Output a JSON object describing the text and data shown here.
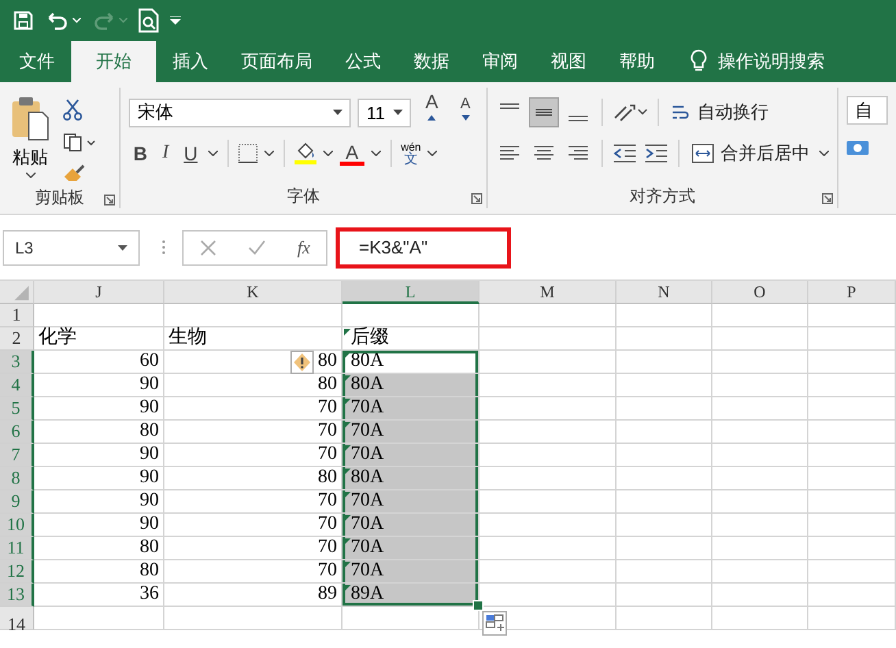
{
  "tabs": [
    {
      "label": "文件",
      "selected": false
    },
    {
      "label": "开始",
      "selected": true
    },
    {
      "label": "插入",
      "selected": false
    },
    {
      "label": "页面布局",
      "selected": false
    },
    {
      "label": "公式",
      "selected": false
    },
    {
      "label": "数据",
      "selected": false
    },
    {
      "label": "审阅",
      "selected": false
    },
    {
      "label": "视图",
      "selected": false
    },
    {
      "label": "帮助",
      "selected": false
    }
  ],
  "tell_me": "操作说明搜索",
  "ribbon": {
    "clipboard": {
      "paste": "粘贴",
      "label": "剪贴板"
    },
    "font": {
      "name": "宋体",
      "size": "11",
      "grow": "A",
      "shrink": "A",
      "bold": "B",
      "italic": "I",
      "underline": "U",
      "font_color": "A",
      "phonetic_top": "wén",
      "phonetic_bottom": "文",
      "label": "字体"
    },
    "alignment": {
      "wrap_text": "自动换行",
      "merge": "合并后居中",
      "label": "对齐方式"
    },
    "number_format": "自"
  },
  "formula_bar": {
    "name_box": "L3",
    "fx": "fx",
    "formula": "=K3&\"A\"",
    "highlighted": true
  },
  "columns": [
    {
      "label": "J",
      "selected": false
    },
    {
      "label": "K",
      "selected": false
    },
    {
      "label": "L",
      "selected": true
    },
    {
      "label": "M",
      "selected": false
    },
    {
      "label": "N",
      "selected": false
    },
    {
      "label": "O",
      "selected": false
    },
    {
      "label": "P",
      "selected": false
    }
  ],
  "rows": [
    {
      "number": "1",
      "selected": false
    },
    {
      "number": "2",
      "selected": false,
      "kind": "header",
      "j": "化学",
      "k": "生物",
      "l": "后缀"
    },
    {
      "number": "3",
      "selected": true,
      "active": true,
      "j": "60",
      "k": "80",
      "l": "80A",
      "warning": true
    },
    {
      "number": "4",
      "selected": true,
      "active": false,
      "j": "90",
      "k": "80",
      "l": "80A"
    },
    {
      "number": "5",
      "selected": true,
      "active": false,
      "j": "90",
      "k": "70",
      "l": "70A"
    },
    {
      "number": "6",
      "selected": true,
      "active": false,
      "j": "80",
      "k": "70",
      "l": "70A"
    },
    {
      "number": "7",
      "selected": true,
      "active": false,
      "j": "90",
      "k": "70",
      "l": "70A"
    },
    {
      "number": "8",
      "selected": true,
      "active": false,
      "j": "90",
      "k": "80",
      "l": "80A"
    },
    {
      "number": "9",
      "selected": true,
      "active": false,
      "j": "90",
      "k": "70",
      "l": "70A"
    },
    {
      "number": "10",
      "selected": true,
      "active": false,
      "j": "90",
      "k": "70",
      "l": "70A"
    },
    {
      "number": "11",
      "selected": true,
      "active": false,
      "j": "80",
      "k": "70",
      "l": "70A"
    },
    {
      "number": "12",
      "selected": true,
      "active": false,
      "j": "80",
      "k": "70",
      "l": "70A"
    },
    {
      "number": "13",
      "selected": true,
      "active": false,
      "j": "36",
      "k": "89",
      "l": "89A"
    },
    {
      "number": "14",
      "selected": false
    }
  ]
}
